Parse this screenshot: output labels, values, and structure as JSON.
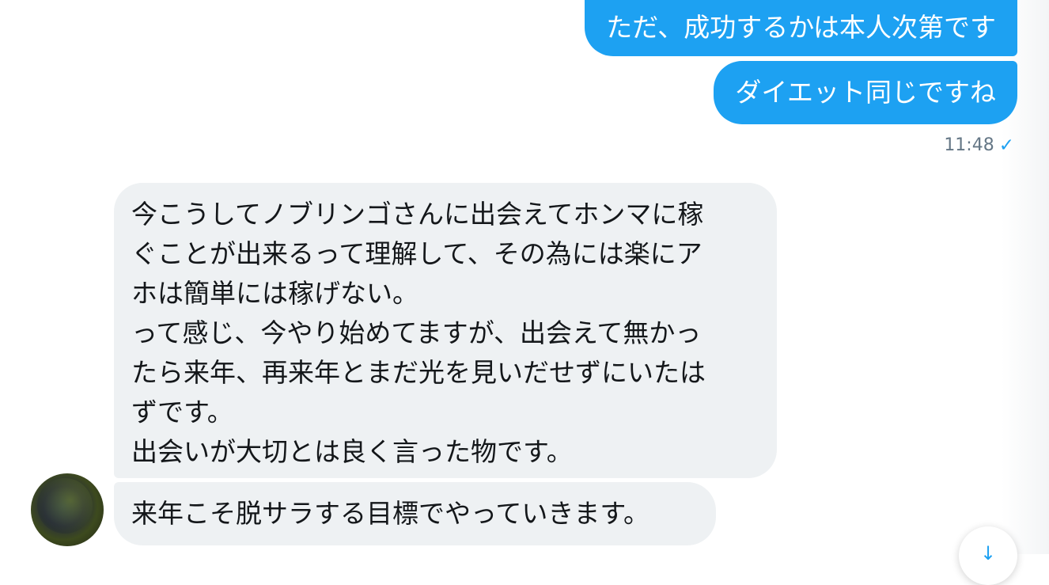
{
  "messages": {
    "outgoing": [
      "ただ、成功するかは本人次第です",
      "ダイエット同じですね"
    ],
    "outgoing_time": "11:48",
    "incoming": [
      "今こうしてノブリンゴさんに出会えてホンマに稼\nぐことが出来るって理解して、その為には楽にア\nホは簡単には稼げない。\nって感じ、今やり始めてますが、出会えて無かっ\nたら来年、再来年とまだ光を見いだせずにいたは\nずです。\n出会いが大切とは良く言った物です。",
      "来年こそ脱サラする目標でやっていきます。"
    ]
  },
  "icons": {
    "read_check": "✓",
    "scroll_down": "↓"
  },
  "colors": {
    "outgoing_bubble": "#1da1f2",
    "incoming_bubble": "#eef1f3",
    "timestamp": "#657786"
  }
}
